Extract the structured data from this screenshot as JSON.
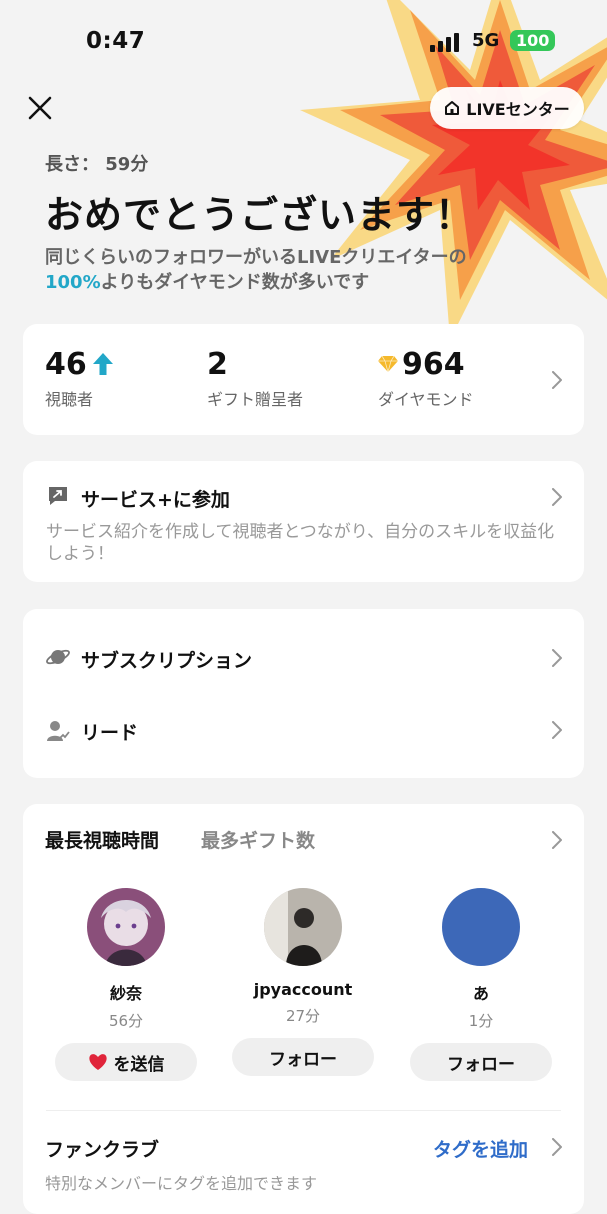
{
  "status_bar": {
    "time": "0:47",
    "network": "5G",
    "battery": "100"
  },
  "header": {
    "live_center_label": "LIVEセンター"
  },
  "hero": {
    "duration_label": "長さ：",
    "duration_value": "59分",
    "headline": "おめでとうございます！",
    "summary_line1": "同じくらいのフォロワーがいるLIVEクリエイターの",
    "summary_percent": "100%",
    "summary_line2": "よりもダイヤモンド数が多いです"
  },
  "stats": [
    {
      "value": "46",
      "label": "視聴者",
      "trend": "up"
    },
    {
      "value": "2",
      "label": "ギフト贈呈者"
    },
    {
      "value": "964",
      "label": "ダイヤモンド"
    }
  ],
  "service": {
    "title": "サービス+に参加",
    "description": "サービス紹介を作成して視聴者とつながり、自分のスキルを収益化しよう！"
  },
  "menu": {
    "subscription": "サブスクリプション",
    "leads": "リード"
  },
  "top_viewers": {
    "tabs": [
      "最長視聴時間",
      "最多ギフト数"
    ],
    "active_tab": "最長視聴時間",
    "viewers": [
      {
        "name": "紗奈",
        "duration": "56分",
        "action": "を送信"
      },
      {
        "name": "jpyaccount",
        "duration": "27分",
        "action": "フォロー"
      },
      {
        "name": "あ",
        "duration": "1分",
        "action": "フォロー"
      }
    ]
  },
  "fan_club": {
    "title": "ファンクラブ",
    "add_tag_label": "タグを追加",
    "description": "特別なメンバーにタグを追加できます"
  },
  "colors": {
    "accent_cyan": "#22a7c8",
    "link_blue": "#2f6cc9",
    "heart_red": "#e0243a",
    "battery_green": "#34c759"
  }
}
